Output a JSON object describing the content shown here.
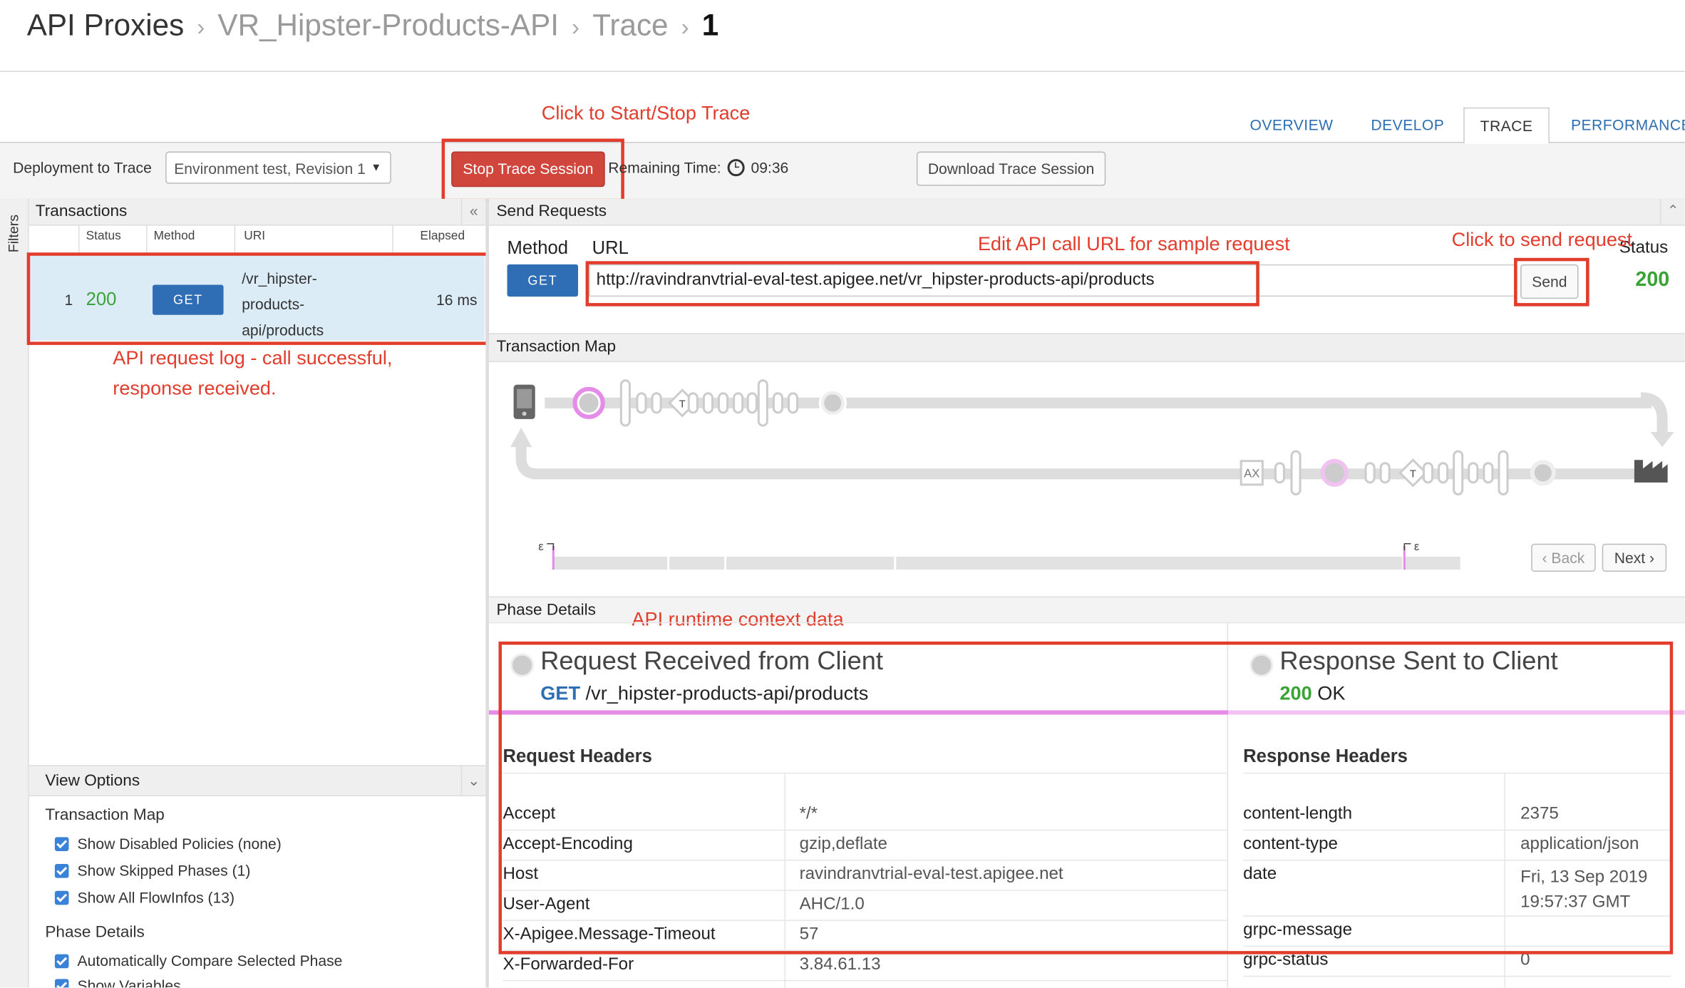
{
  "breadcrumb": {
    "items": [
      "API Proxies",
      "VR_Hipster-Products-API",
      "Trace"
    ],
    "current": "1"
  },
  "tabs": [
    "OVERVIEW",
    "DEVELOP",
    "TRACE",
    "PERFORMANCE"
  ],
  "toolbar": {
    "deployment_label": "Deployment to Trace",
    "deployment_value": "Environment test, Revision 1",
    "stop_button": "Stop Trace Session",
    "remaining_label": "Remaining Time:",
    "remaining_value": "09:36",
    "download_button": "Download Trace Session"
  },
  "annotations": {
    "start_stop": "Click to Start/Stop Trace",
    "edit_url": "Edit API call URL for sample request",
    "send": "Click to send request",
    "log_line1": "API request log - call successful,",
    "log_line2": "response received.",
    "context": "API runtime context data"
  },
  "sidebar": {
    "filters": "Filters"
  },
  "transactions": {
    "title": "Transactions",
    "columns": [
      "Status",
      "Method",
      "URI",
      "Elapsed"
    ],
    "rows": [
      {
        "index": "1",
        "status": "200",
        "method": "GET",
        "uri": [
          "/vr_hipster-",
          "products-",
          "api/products"
        ],
        "elapsed": "16 ms"
      }
    ]
  },
  "view_options": {
    "title": "View Options",
    "transaction_map_title": "Transaction Map",
    "transaction_map_options": [
      "Show Disabled Policies (none)",
      "Show Skipped Phases (1)",
      "Show All FlowInfos (13)"
    ],
    "phase_details_title": "Phase Details",
    "phase_details_options": [
      "Automatically Compare Selected Phase",
      "Show Variables"
    ]
  },
  "send_requests": {
    "title": "Send Requests",
    "method_label": "Method",
    "url_label": "URL",
    "method": "GET",
    "url": "http://ravindranvtrial-eval-test.apigee.net/vr_hipster-products-api/products",
    "send_button": "Send",
    "status_label": "Status",
    "status": "200"
  },
  "transaction_map": {
    "title": "Transaction Map",
    "back": "Back",
    "next": "Next",
    "ax": "AX",
    "t": "T",
    "eps": "ε"
  },
  "phase_details": {
    "title": "Phase Details",
    "request": {
      "title": "Request Received from Client",
      "method": "GET",
      "path": "/vr_hipster-products-api/products",
      "headers_title": "Request Headers",
      "headers": [
        {
          "name": "Accept",
          "value": "*/*"
        },
        {
          "name": "Accept-Encoding",
          "value": "gzip,deflate"
        },
        {
          "name": "Host",
          "value": "ravindranvtrial-eval-test.apigee.net"
        },
        {
          "name": "User-Agent",
          "value": "AHC/1.0"
        },
        {
          "name": "X-Apigee.Message-Timeout",
          "value": "57"
        },
        {
          "name": "X-Forwarded-For",
          "value": "3.84.61.13"
        }
      ]
    },
    "response": {
      "title": "Response Sent to Client",
      "status_code": "200",
      "status_text": "OK",
      "headers_title": "Response Headers",
      "headers": [
        {
          "name": "content-length",
          "value": "2375"
        },
        {
          "name": "content-type",
          "value": "application/json"
        },
        {
          "name": "date",
          "value": "Fri, 13 Sep 2019",
          "value2": "19:57:37 GMT"
        },
        {
          "name": "grpc-message",
          "value": ""
        },
        {
          "name": "grpc-status",
          "value": "0"
        }
      ]
    }
  },
  "colors": {
    "accent": "#2e6fb3",
    "success": "#3aa335",
    "danger": "#d9463b",
    "annotation": "#e13c2c",
    "flow": "#e58be8"
  }
}
